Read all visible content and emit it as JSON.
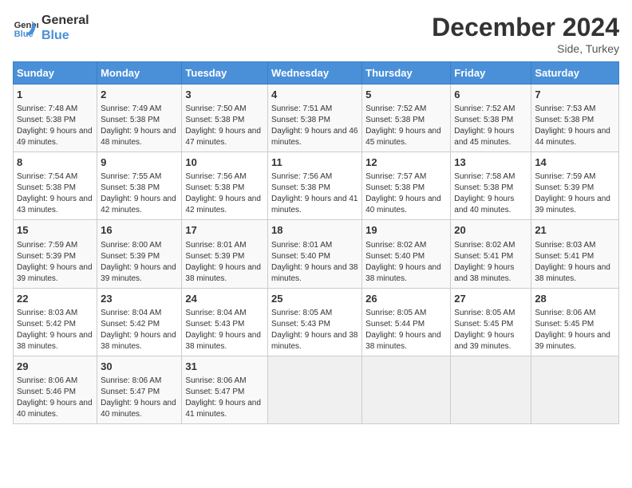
{
  "header": {
    "logo_line1": "General",
    "logo_line2": "Blue",
    "month": "December 2024",
    "location": "Side, Turkey"
  },
  "days_of_week": [
    "Sunday",
    "Monday",
    "Tuesday",
    "Wednesday",
    "Thursday",
    "Friday",
    "Saturday"
  ],
  "weeks": [
    [
      {
        "day": 1,
        "sunrise": "7:48 AM",
        "sunset": "5:38 PM",
        "daylight": "9 hours and 49 minutes."
      },
      {
        "day": 2,
        "sunrise": "7:49 AM",
        "sunset": "5:38 PM",
        "daylight": "9 hours and 48 minutes."
      },
      {
        "day": 3,
        "sunrise": "7:50 AM",
        "sunset": "5:38 PM",
        "daylight": "9 hours and 47 minutes."
      },
      {
        "day": 4,
        "sunrise": "7:51 AM",
        "sunset": "5:38 PM",
        "daylight": "9 hours and 46 minutes."
      },
      {
        "day": 5,
        "sunrise": "7:52 AM",
        "sunset": "5:38 PM",
        "daylight": "9 hours and 45 minutes."
      },
      {
        "day": 6,
        "sunrise": "7:52 AM",
        "sunset": "5:38 PM",
        "daylight": "9 hours and 45 minutes."
      },
      {
        "day": 7,
        "sunrise": "7:53 AM",
        "sunset": "5:38 PM",
        "daylight": "9 hours and 44 minutes."
      }
    ],
    [
      {
        "day": 8,
        "sunrise": "7:54 AM",
        "sunset": "5:38 PM",
        "daylight": "9 hours and 43 minutes."
      },
      {
        "day": 9,
        "sunrise": "7:55 AM",
        "sunset": "5:38 PM",
        "daylight": "9 hours and 42 minutes."
      },
      {
        "day": 10,
        "sunrise": "7:56 AM",
        "sunset": "5:38 PM",
        "daylight": "9 hours and 42 minutes."
      },
      {
        "day": 11,
        "sunrise": "7:56 AM",
        "sunset": "5:38 PM",
        "daylight": "9 hours and 41 minutes."
      },
      {
        "day": 12,
        "sunrise": "7:57 AM",
        "sunset": "5:38 PM",
        "daylight": "9 hours and 40 minutes."
      },
      {
        "day": 13,
        "sunrise": "7:58 AM",
        "sunset": "5:38 PM",
        "daylight": "9 hours and 40 minutes."
      },
      {
        "day": 14,
        "sunrise": "7:59 AM",
        "sunset": "5:39 PM",
        "daylight": "9 hours and 39 minutes."
      }
    ],
    [
      {
        "day": 15,
        "sunrise": "7:59 AM",
        "sunset": "5:39 PM",
        "daylight": "9 hours and 39 minutes."
      },
      {
        "day": 16,
        "sunrise": "8:00 AM",
        "sunset": "5:39 PM",
        "daylight": "9 hours and 39 minutes."
      },
      {
        "day": 17,
        "sunrise": "8:01 AM",
        "sunset": "5:39 PM",
        "daylight": "9 hours and 38 minutes."
      },
      {
        "day": 18,
        "sunrise": "8:01 AM",
        "sunset": "5:40 PM",
        "daylight": "9 hours and 38 minutes."
      },
      {
        "day": 19,
        "sunrise": "8:02 AM",
        "sunset": "5:40 PM",
        "daylight": "9 hours and 38 minutes."
      },
      {
        "day": 20,
        "sunrise": "8:02 AM",
        "sunset": "5:41 PM",
        "daylight": "9 hours and 38 minutes."
      },
      {
        "day": 21,
        "sunrise": "8:03 AM",
        "sunset": "5:41 PM",
        "daylight": "9 hours and 38 minutes."
      }
    ],
    [
      {
        "day": 22,
        "sunrise": "8:03 AM",
        "sunset": "5:42 PM",
        "daylight": "9 hours and 38 minutes."
      },
      {
        "day": 23,
        "sunrise": "8:04 AM",
        "sunset": "5:42 PM",
        "daylight": "9 hours and 38 minutes."
      },
      {
        "day": 24,
        "sunrise": "8:04 AM",
        "sunset": "5:43 PM",
        "daylight": "9 hours and 38 minutes."
      },
      {
        "day": 25,
        "sunrise": "8:05 AM",
        "sunset": "5:43 PM",
        "daylight": "9 hours and 38 minutes."
      },
      {
        "day": 26,
        "sunrise": "8:05 AM",
        "sunset": "5:44 PM",
        "daylight": "9 hours and 38 minutes."
      },
      {
        "day": 27,
        "sunrise": "8:05 AM",
        "sunset": "5:45 PM",
        "daylight": "9 hours and 39 minutes."
      },
      {
        "day": 28,
        "sunrise": "8:06 AM",
        "sunset": "5:45 PM",
        "daylight": "9 hours and 39 minutes."
      }
    ],
    [
      {
        "day": 29,
        "sunrise": "8:06 AM",
        "sunset": "5:46 PM",
        "daylight": "9 hours and 40 minutes."
      },
      {
        "day": 30,
        "sunrise": "8:06 AM",
        "sunset": "5:47 PM",
        "daylight": "9 hours and 40 minutes."
      },
      {
        "day": 31,
        "sunrise": "8:06 AM",
        "sunset": "5:47 PM",
        "daylight": "9 hours and 41 minutes."
      },
      null,
      null,
      null,
      null
    ]
  ]
}
